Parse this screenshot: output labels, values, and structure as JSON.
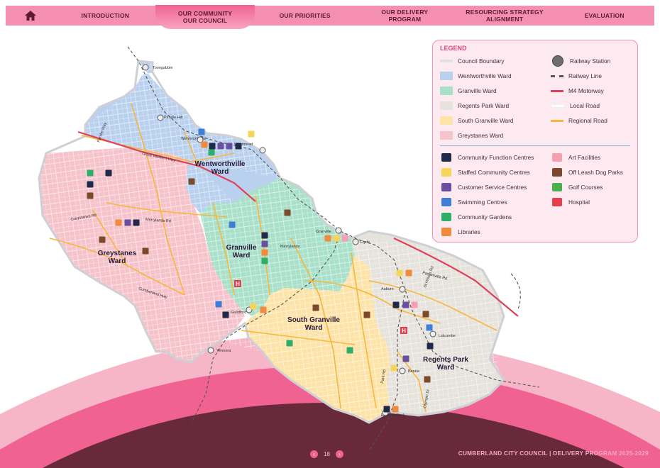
{
  "nav": {
    "home_icon": "home-icon",
    "tabs": [
      {
        "label": "INTRODUCTION"
      },
      {
        "label": "OUR COMMUNITY\nOUR COUNCIL"
      },
      {
        "label": "OUR PRIORITIES"
      },
      {
        "label": "OUR DELIVERY\nPROGRAM"
      },
      {
        "label": "RESOURCING STRATEGY\nALIGNMENT"
      },
      {
        "label": "EVALUATION"
      }
    ],
    "active_index": 1,
    "color": "#f48fb1"
  },
  "map": {
    "wards": [
      {
        "name": "Wentworthville\nWard",
        "color": "#b9d1ee"
      },
      {
        "name": "Granville\nWard",
        "color": "#a8e0c9"
      },
      {
        "name": "Greystanes\nWard",
        "color": "#f6c3cb"
      },
      {
        "name": "South Granville\nWard",
        "color": "#fde3a7"
      },
      {
        "name": "Regents Park\nWard",
        "color": "#e6e2dc"
      }
    ],
    "places": [
      "Toongabbie",
      "Pendle Hill",
      "Wentworthville",
      "Westmead",
      "Merrylands",
      "Granville",
      "Clyde",
      "Auburn",
      "Guildford",
      "Yennora",
      "Lidcombe",
      "Berala",
      "Regents Park"
    ],
    "streets": [
      "Great Western Hwy",
      "Cumberland Hwy",
      "Merrylands Rd",
      "Greystanes Rd",
      "Parramatta Rd",
      "St Hilliers Rd",
      "Olympic Dr",
      "Park Rd",
      "Pendle Way"
    ]
  },
  "legend": {
    "title": "LEGEND",
    "col1": [
      {
        "label": "Council Boundary",
        "color": "#e0e0e4",
        "icon": "boundary-swatch"
      },
      {
        "label": "Wentworthville Ward",
        "color": "#b9d1ee",
        "icon": "ward-swatch"
      },
      {
        "label": "Granville Ward",
        "color": "#a8e0c9",
        "icon": "ward-swatch"
      },
      {
        "label": "Regents Park Ward",
        "color": "#e6e2dc",
        "icon": "ward-swatch"
      },
      {
        "label": "South Granville Ward",
        "color": "#fde3a7",
        "icon": "ward-swatch"
      },
      {
        "label": "Greystanes Ward",
        "color": "#f6c3cb",
        "icon": "ward-swatch"
      }
    ],
    "col2": [
      {
        "label": "Railway Station",
        "color": "#6d6d6d",
        "icon": "railway-station-icon"
      },
      {
        "label": "Railway Line",
        "color": "#555555",
        "icon": "railway-line-swatch"
      },
      {
        "label": "M4 Motorway",
        "color": "#e0405a",
        "icon": "motorway-swatch"
      },
      {
        "label": "Local Road",
        "color": "#ffffff",
        "icon": "local-road-swatch"
      },
      {
        "label": "Regional Road",
        "color": "#f6b73c",
        "icon": "regional-road-swatch"
      }
    ],
    "facilities1": [
      {
        "label": "Community Function Centres",
        "color": "#1f2a4a",
        "icon": "community-function-icon"
      },
      {
        "label": "Staffed Community Centres",
        "color": "#f7d45a",
        "icon": "staffed-community-icon"
      },
      {
        "label": "Customer Service Centres",
        "color": "#6a4fa0",
        "icon": "customer-service-icon"
      },
      {
        "label": "Swimming Centres",
        "color": "#3d7ed8",
        "icon": "swimming-icon"
      },
      {
        "label": "Community Gardens",
        "color": "#2fae6a",
        "icon": "community-garden-icon"
      },
      {
        "label": "Libraries",
        "color": "#f08a3c",
        "icon": "library-icon"
      }
    ],
    "facilities2": [
      {
        "label": "Art Facilities",
        "color": "#f59fb3",
        "icon": "art-facility-icon"
      },
      {
        "label": "Off Leash Dog Parks",
        "color": "#7a4a2a",
        "icon": "dog-park-icon"
      },
      {
        "label": "Golf Courses",
        "color": "#4cae4c",
        "icon": "golf-icon"
      },
      {
        "label": "Hospital",
        "color": "#e2404e",
        "icon": "hospital-icon"
      }
    ]
  },
  "footer": {
    "page": "18",
    "prev_icon": "chevron-left-icon",
    "next_icon": "chevron-right-icon",
    "title": "CUMBERLAND CITY COUNCIL  |  DELIVERY PROGRAM 2025-2029"
  }
}
